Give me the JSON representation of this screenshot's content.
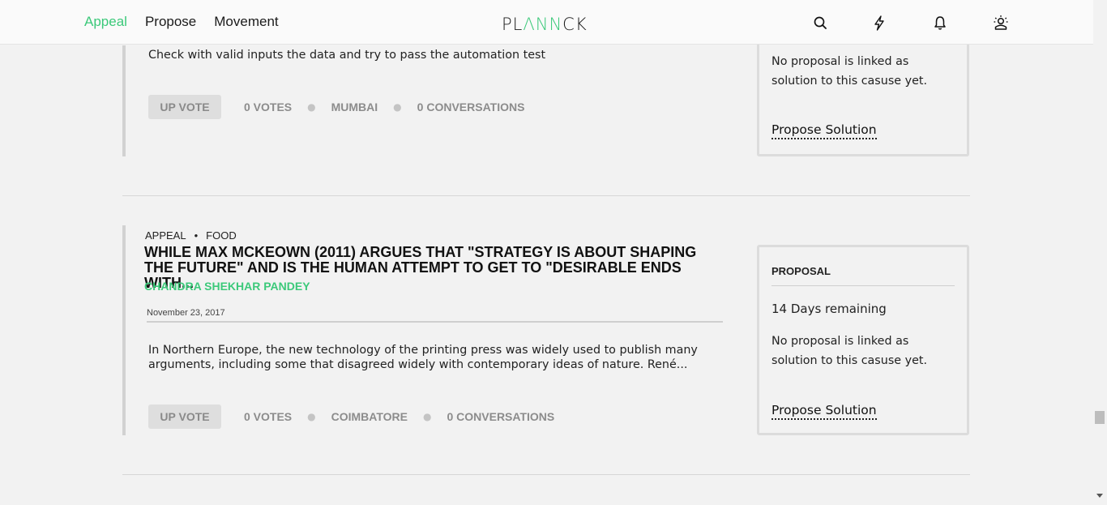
{
  "nav": {
    "items": [
      {
        "label": "Appeal",
        "active": true
      },
      {
        "label": "Propose",
        "active": false
      },
      {
        "label": "Movement",
        "active": false
      }
    ]
  },
  "logo": {
    "part1": "PL",
    "part2": "ΛNN",
    "part3": "CK"
  },
  "header_icons": [
    "search-icon",
    "lightning-icon",
    "bell-icon",
    "user-icon"
  ],
  "colors": {
    "accent": "#3cc97a",
    "text": "#222222",
    "muted": "#8c8c8c",
    "background": "#f2f2f2"
  },
  "posts": [
    {
      "excerpt": "Check with valid inputs the data and try to pass the automation test",
      "upvote_label": "UP VOTE",
      "votes": "0 VOTES",
      "location": "MUMBAI",
      "conversations": "0 CONVERSATIONS",
      "proposal_text": "No proposal is linked as solution to this casuse yet.",
      "proposal_link": "Propose Solution"
    },
    {
      "type": "APPEAL",
      "category": "FOOD",
      "title": "WHILE MAX MCKEOWN (2011) ARGUES THAT \"STRATEGY IS ABOUT SHAPING THE FUTURE\" AND IS THE HUMAN ATTEMPT TO GET TO \"DESIRABLE ENDS WITH...",
      "author": "CHANDRA SHEKHAR PANDEY",
      "date": "November 23, 2017",
      "excerpt": "In Northern Europe, the new technology of the printing press was widely used to publish many arguments, including some that disagreed widely with contemporary ideas of nature. René...",
      "upvote_label": "UP VOTE",
      "votes": "0 VOTES",
      "location": "COIMBATORE",
      "conversations": "0 CONVERSATIONS",
      "proposal_label": "PROPOSAL",
      "proposal_days": "14 Days remaining",
      "proposal_text": "No proposal is linked as solution to this casuse yet.",
      "proposal_link": "Propose Solution"
    }
  ]
}
